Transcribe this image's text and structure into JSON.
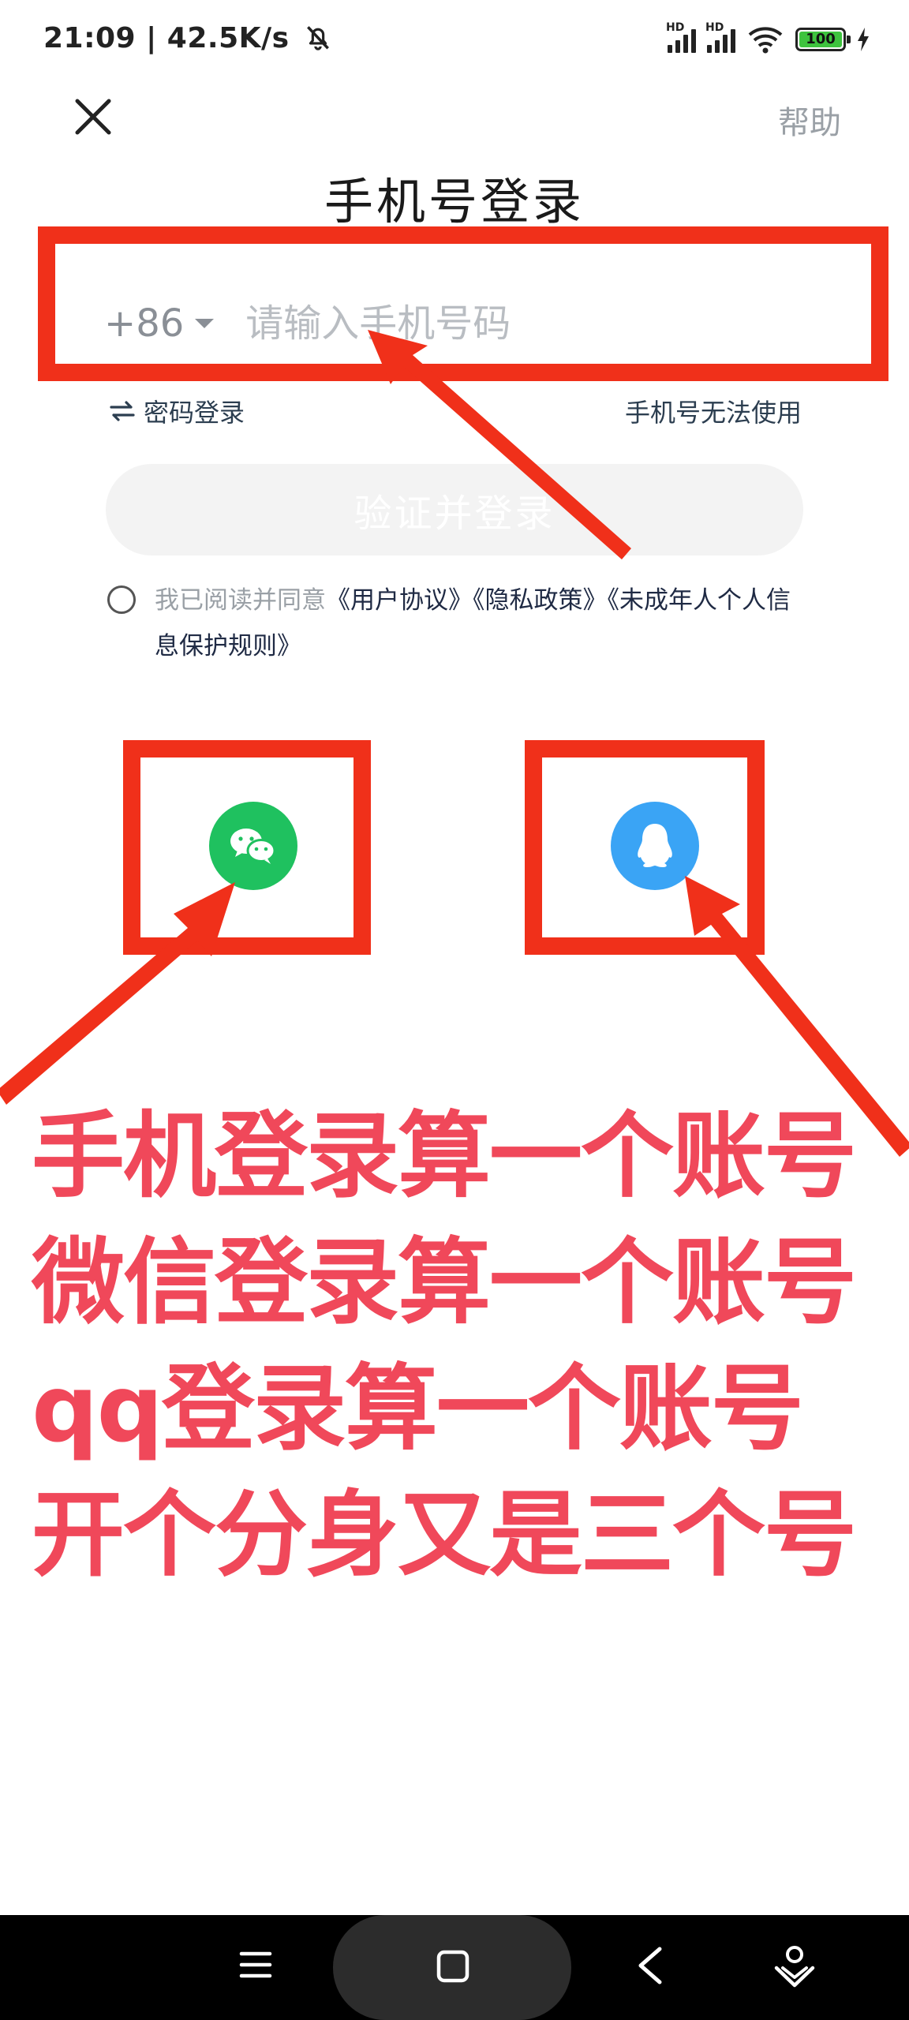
{
  "status_bar": {
    "time": "21:09 | 42.5K/s",
    "hd": "HD",
    "battery": "100"
  },
  "header": {
    "help": "帮助",
    "title": "手机号登录"
  },
  "phone": {
    "country_code": "+86",
    "placeholder": "请输入手机号码"
  },
  "links": {
    "password_login": "密码登录",
    "phone_unusable": "手机号无法使用"
  },
  "login_button": "验证并登录",
  "agreement": {
    "prefix": "我已阅读并同意",
    "user_agreement": "《用户协议》",
    "privacy_policy": "《隐私政策》",
    "minor_policy": "《未成年人个人信息保护规则》"
  },
  "annotation": {
    "line1": "手机登录算一个账号",
    "line2": "微信登录算一个账号",
    "line3": "qq登录算一个账号",
    "line4": "开个分身又是三个号"
  },
  "colors": {
    "annotation_red": "#f0301a",
    "annotation_text": "#f0485a",
    "wechat_green": "#1fc15f",
    "qq_blue": "#3aa4f5"
  },
  "icons": {
    "wechat": "wechat-icon",
    "qq": "qq-penguin-icon",
    "close": "close-icon",
    "swap": "swap-arrows-icon"
  }
}
